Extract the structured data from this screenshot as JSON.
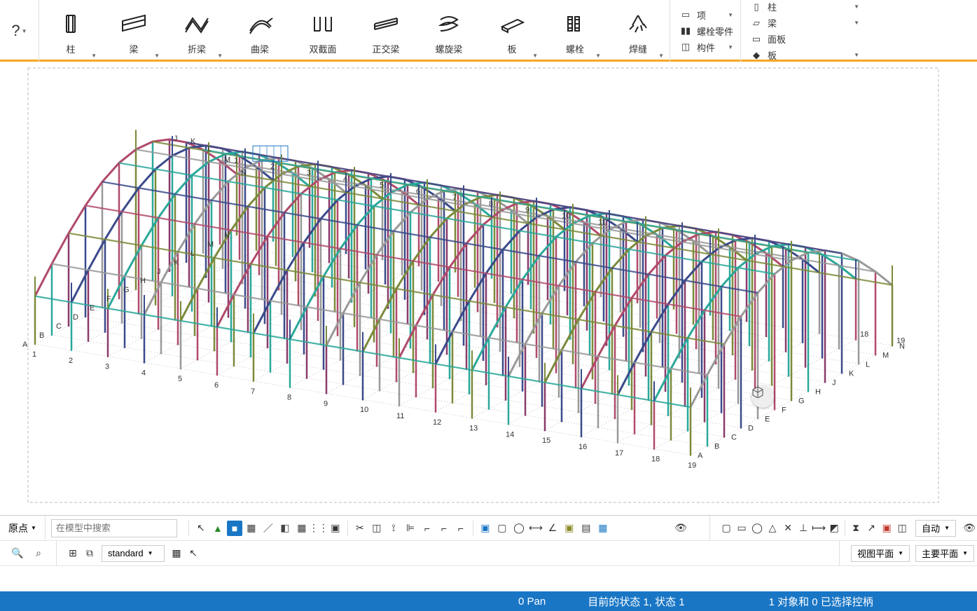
{
  "help": "?",
  "ribbon": [
    {
      "id": "column",
      "label": "柱"
    },
    {
      "id": "beam",
      "label": "梁"
    },
    {
      "id": "polybeam",
      "label": "折梁"
    },
    {
      "id": "curvedbeam",
      "label": "曲梁"
    },
    {
      "id": "twinprofile",
      "label": "双截面"
    },
    {
      "id": "orthobeam",
      "label": "正交梁"
    },
    {
      "id": "spiralbeam",
      "label": "螺旋梁"
    },
    {
      "id": "plate",
      "label": "板"
    },
    {
      "id": "bolt",
      "label": "螺栓"
    },
    {
      "id": "weld",
      "label": "焊缝"
    }
  ],
  "sideGroup1": [
    {
      "id": "item",
      "label": "项"
    },
    {
      "id": "boltparts",
      "label": "螺栓零件"
    },
    {
      "id": "component",
      "label": "构件"
    }
  ],
  "sideGroup2": [
    {
      "id": "col2",
      "label": "柱"
    },
    {
      "id": "beam2",
      "label": "梁"
    },
    {
      "id": "panel",
      "label": "面板"
    },
    {
      "id": "plate2",
      "label": "板"
    }
  ],
  "grid": {
    "numeric": [
      "1",
      "2",
      "3",
      "4",
      "5",
      "6",
      "7",
      "8",
      "9",
      "10",
      "11",
      "12",
      "13",
      "14",
      "15",
      "16",
      "17",
      "18",
      "19"
    ],
    "alpha": [
      "A",
      "B",
      "C",
      "D",
      "E",
      "F",
      "G",
      "H",
      "J",
      "K",
      "L",
      "M",
      "N"
    ]
  },
  "lower": {
    "origin": "原点",
    "searchPlaceholder": "在模型中搜索",
    "standard": "standard",
    "viewPlane": "视图平面",
    "mainPlane": "主要平面",
    "auto": "自动"
  },
  "status": {
    "pan": "0  Pan",
    "state": "目前的状态 1, 状态 1",
    "selection": "1 对象和 0 已选择控柄"
  }
}
